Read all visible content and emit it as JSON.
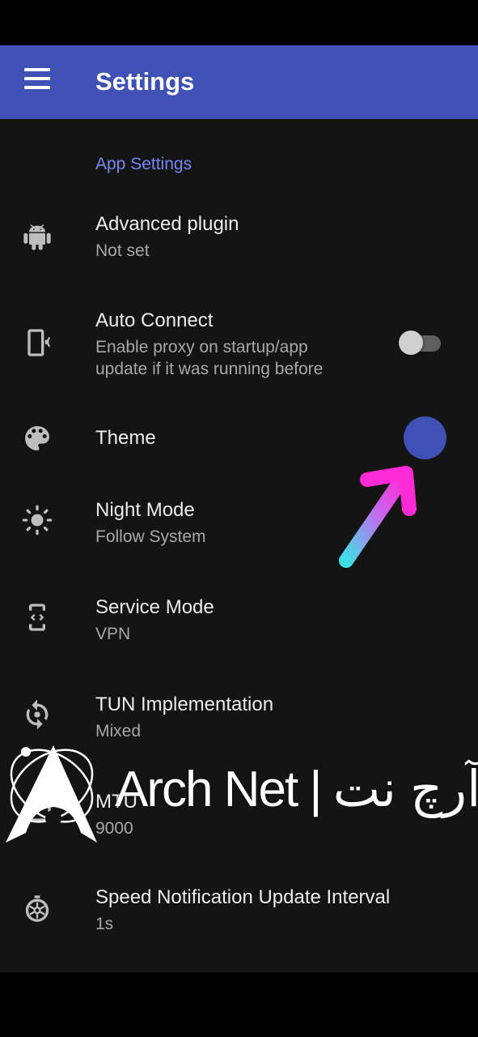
{
  "app_bar": {
    "title": "Settings"
  },
  "section": {
    "header": "App Settings"
  },
  "prefs": [
    {
      "title": "Advanced plugin",
      "summary": "Not set",
      "icon": "android-icon"
    },
    {
      "title": "Auto Connect",
      "summary_line1": "Enable proxy on startup/app",
      "summary_line2": "update if it was running before",
      "icon": "phone-vibrate-icon",
      "switch_on": false
    },
    {
      "title": "Theme",
      "icon": "palette-icon",
      "swatch_color": "#3f51b5"
    },
    {
      "title": "Night Mode",
      "summary": "Follow System",
      "icon": "brightness-icon"
    },
    {
      "title": "Service Mode",
      "summary": "VPN",
      "icon": "phone-link-icon"
    },
    {
      "title": "TUN Implementation",
      "summary": "Mixed",
      "icon": "sync-icon"
    },
    {
      "title": "MTU",
      "summary": "9000",
      "icon": "mtu-icon"
    },
    {
      "title": "Speed Notification Update Interval",
      "summary": "1s",
      "icon": "timer-icon"
    }
  ],
  "watermark": {
    "text": "Arch Net | آرچ نت"
  },
  "colors": {
    "primary": "#3f51b5",
    "accent": "#7986f5",
    "background": "#141414",
    "arrow_gradient_start": "#3ee0e8",
    "arrow_gradient_end": "#ff2bd6"
  }
}
